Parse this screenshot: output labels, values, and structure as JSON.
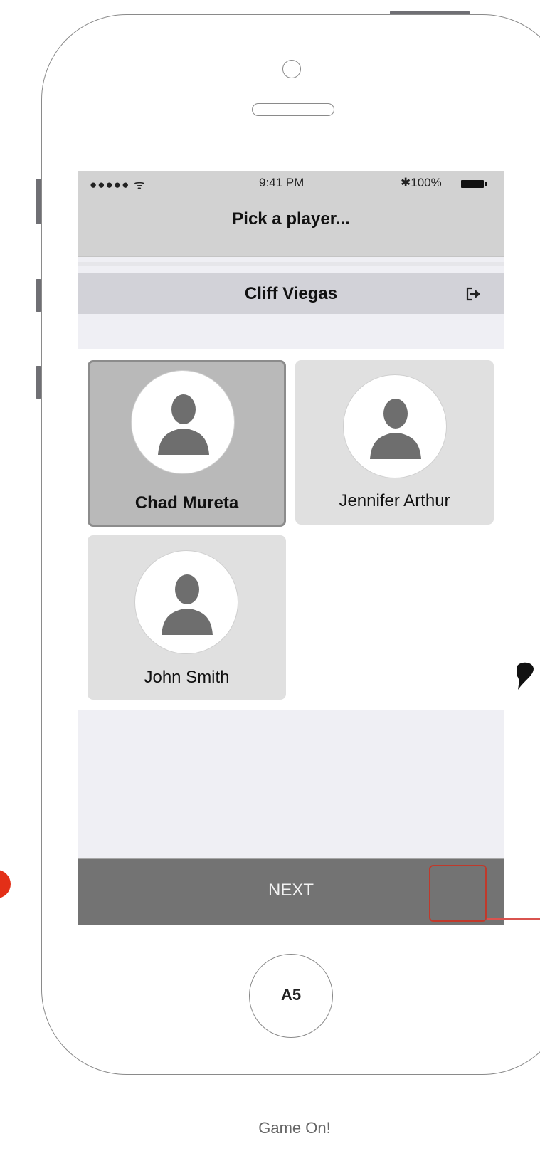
{
  "status_bar": {
    "signal": "●●●●● ᯤ",
    "time": "9:41 PM",
    "battery": "✱100%",
    "battery_icon": "battery-full-icon"
  },
  "nav": {
    "title": "Pick a player..."
  },
  "user_bar": {
    "name": "Cliff Viegas",
    "logout_icon": "logout-icon"
  },
  "players": [
    {
      "name": "Chad Mureta",
      "selected": true
    },
    {
      "name": "Jennifer Arthur",
      "selected": false
    },
    {
      "name": "John Smith",
      "selected": false
    }
  ],
  "footer": {
    "next_label": "NEXT"
  },
  "home_button": {
    "label": "A5"
  },
  "caption": "Game On!",
  "colors": {
    "accent": "#737373",
    "selected_card": "#b9b9b9",
    "card": "#e0e0e0",
    "hotspot": "#c0392b"
  }
}
